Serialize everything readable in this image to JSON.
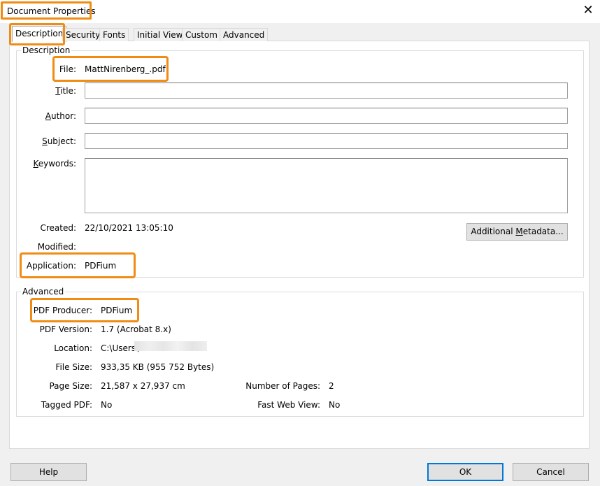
{
  "window": {
    "title": "Document Properties",
    "close_glyph": "✕"
  },
  "tabs": [
    {
      "label": "Description"
    },
    {
      "label": "Security"
    },
    {
      "label": "Fonts"
    },
    {
      "label": "Initial View"
    },
    {
      "label": "Custom"
    },
    {
      "label": "Advanced"
    }
  ],
  "description": {
    "group_label": "Description",
    "file_label": "File:",
    "file_value": "MattNirenberg_.pdf",
    "title_label": "Title:",
    "title_value": "",
    "author_label": "Author:",
    "author_value": "",
    "subject_label": "Subject:",
    "subject_value": "",
    "keywords_label": "Keywords:",
    "keywords_value": "",
    "created_label": "Created:",
    "created_value": "22/10/2021 13:05:10",
    "modified_label": "Modified:",
    "modified_value": "",
    "application_label": "Application:",
    "application_value": "PDFium",
    "metadata_button": "Additional Metadata..."
  },
  "advanced": {
    "group_label": "Advanced",
    "producer_label": "PDF Producer:",
    "producer_value": "PDFium",
    "version_label": "PDF Version:",
    "version_value": "1.7 (Acrobat 8.x)",
    "location_label": "Location:",
    "location_value": "C:\\Users\\",
    "filesize_label": "File Size:",
    "filesize_value": "933,35 KB (955 752 Bytes)",
    "pagesize_label": "Page Size:",
    "pagesize_value": "21,587 x 27,937 cm",
    "pages_label": "Number of Pages:",
    "pages_value": "2",
    "tagged_label": "Tagged PDF:",
    "tagged_value": "No",
    "fastweb_label": "Fast Web View:",
    "fastweb_value": "No"
  },
  "footer": {
    "help": "Help",
    "ok": "OK",
    "cancel": "Cancel"
  },
  "colors": {
    "highlight": "#f08c14",
    "primary_border": "#0078d7"
  }
}
